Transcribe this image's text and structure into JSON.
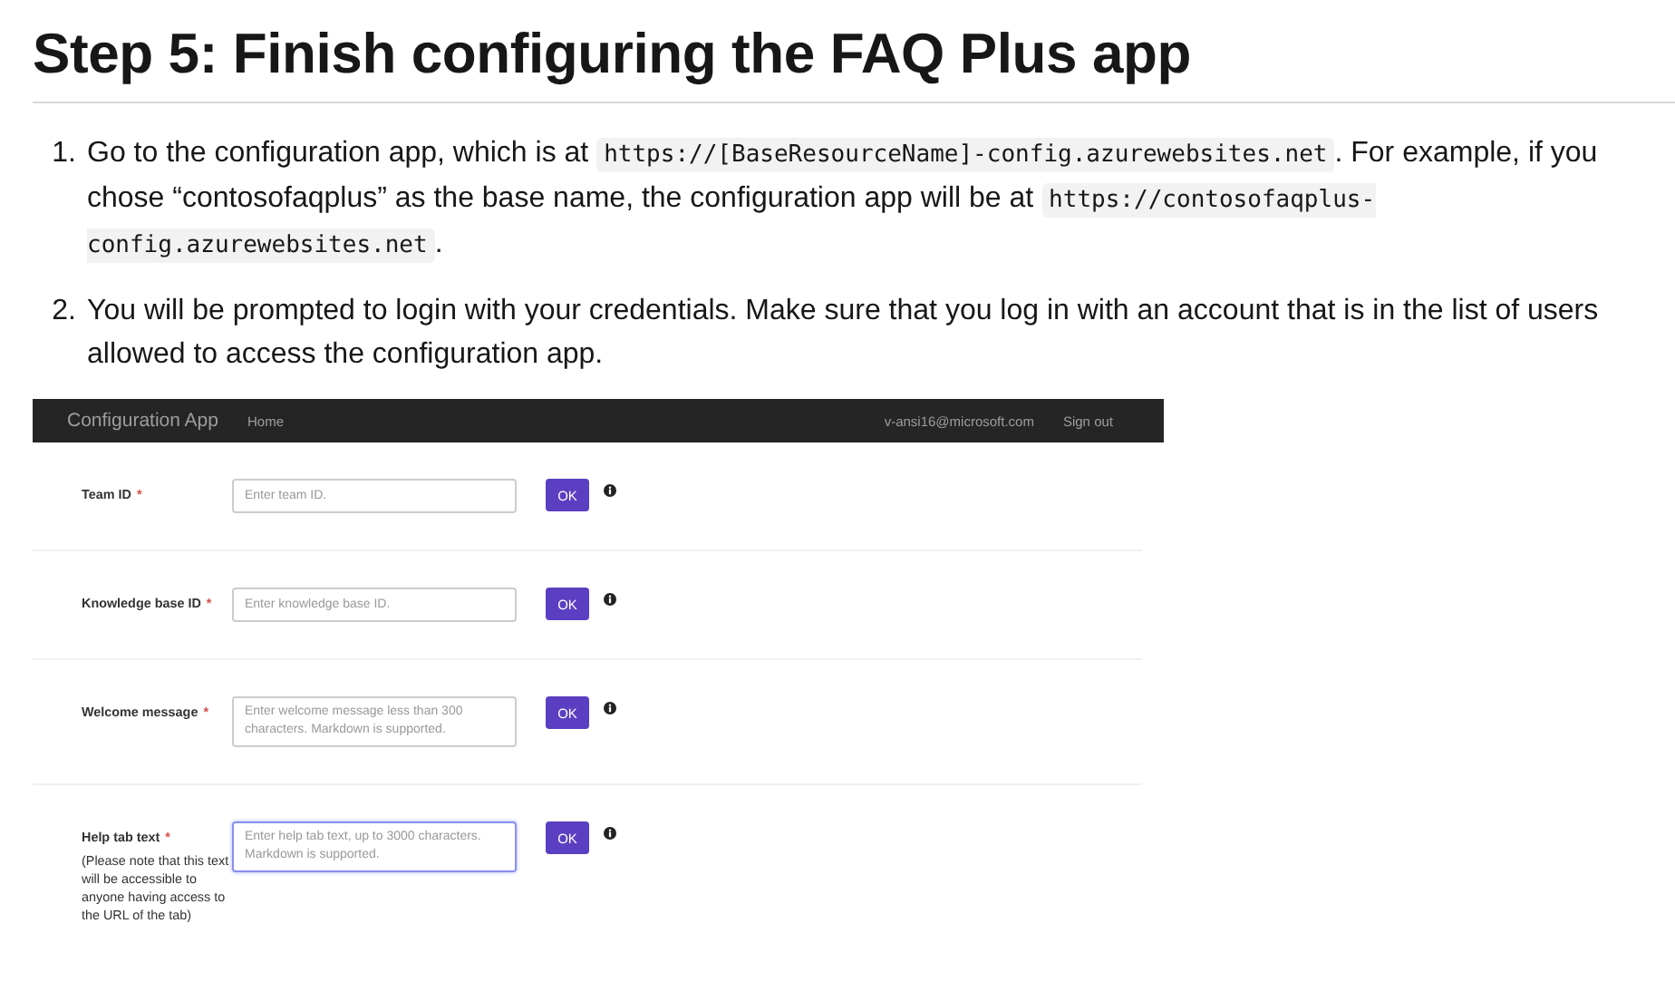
{
  "heading": "Step 5: Finish configuring the FAQ Plus app",
  "steps": [
    {
      "number": "1.",
      "segments": [
        {
          "kind": "text",
          "text": "Go to the configuration app, which is at "
        },
        {
          "kind": "code",
          "text": "https://[BaseResourceName]-config.azurewebsites.net"
        },
        {
          "kind": "text",
          "text": ". For example, if you chose “contosofaqplus” as the base name, the configuration app will be at "
        },
        {
          "kind": "code",
          "text": "https://contosofaqplus-config.azurewebsites.net"
        },
        {
          "kind": "text",
          "text": "."
        }
      ]
    },
    {
      "number": "2.",
      "segments": [
        {
          "kind": "text",
          "text": "You will be prompted to login with your credentials. Make sure that you log in with an account that is in the list of users allowed to access the configuration app."
        }
      ]
    }
  ],
  "app": {
    "brand": "Configuration App",
    "nav": [
      "Home"
    ],
    "user": "v-ansi16@microsoft.com",
    "sign_out": "Sign out",
    "fields": [
      {
        "label": "Team ID",
        "marker": "*",
        "kind": "input",
        "placeholder": "Enter team ID.",
        "focused": false,
        "button": "OK"
      },
      {
        "label": "Knowledge base ID",
        "marker": "*",
        "kind": "input",
        "placeholder": "Enter knowledge base ID.",
        "focused": false,
        "button": "OK"
      },
      {
        "label": "Welcome message",
        "marker": "*",
        "kind": "textarea",
        "placeholder": "Enter welcome message less than 300 characters. Markdown is supported.",
        "focused": false,
        "button": "OK"
      },
      {
        "label": "Help tab text",
        "marker": "*",
        "note": "(Please note that this text will be accessible to anyone having access to the URL of the tab)",
        "kind": "textarea",
        "placeholder": "Enter help tab text, up to 3000 characters. Markdown is supported.",
        "focused": true,
        "button": "OK"
      }
    ]
  }
}
